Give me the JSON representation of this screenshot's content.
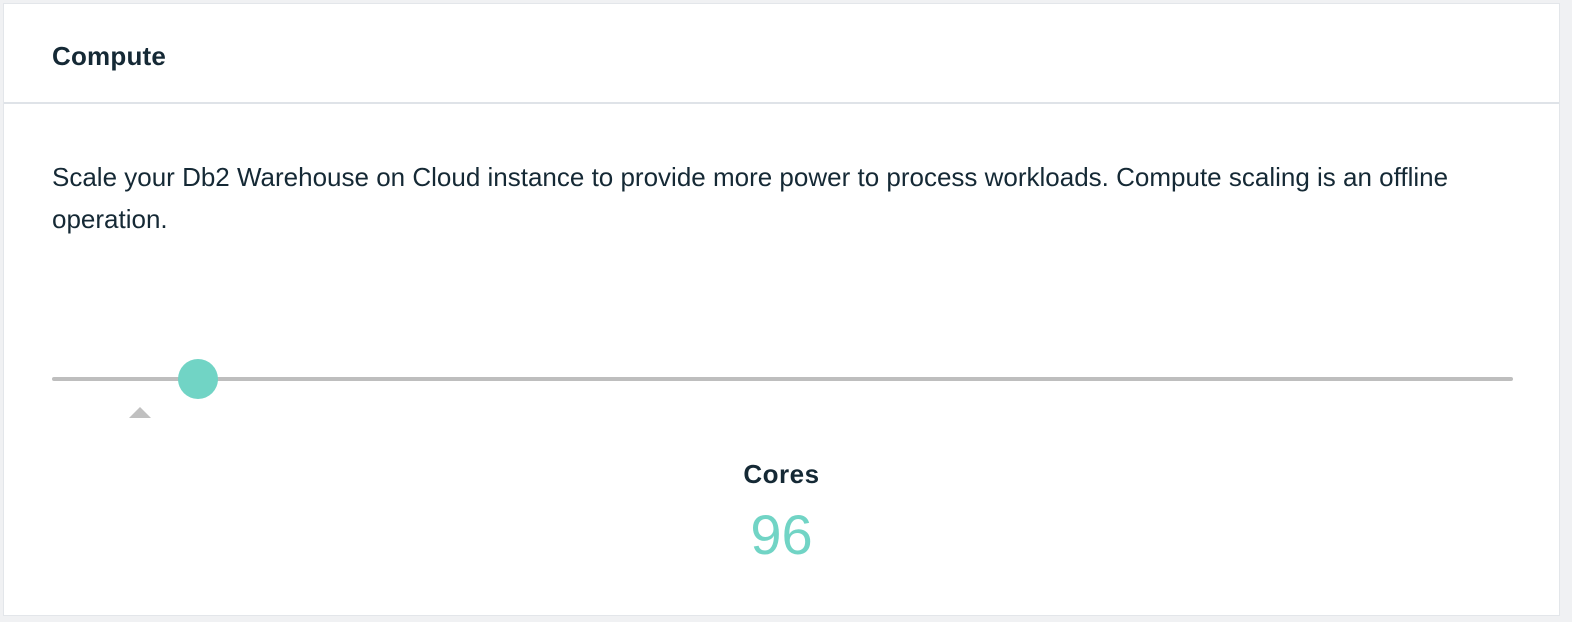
{
  "panel": {
    "title": "Compute",
    "description": "Scale your Db2 Warehouse on Cloud instance to provide more power to process workloads. Compute scaling is an offline operation."
  },
  "slider": {
    "value_fraction": 0.1,
    "marker_fraction": 0.06,
    "track_color": "#bebebe",
    "thumb_color": "#71d4c5"
  },
  "cores": {
    "label": "Cores",
    "value": "96",
    "value_color": "#71d4c5"
  }
}
